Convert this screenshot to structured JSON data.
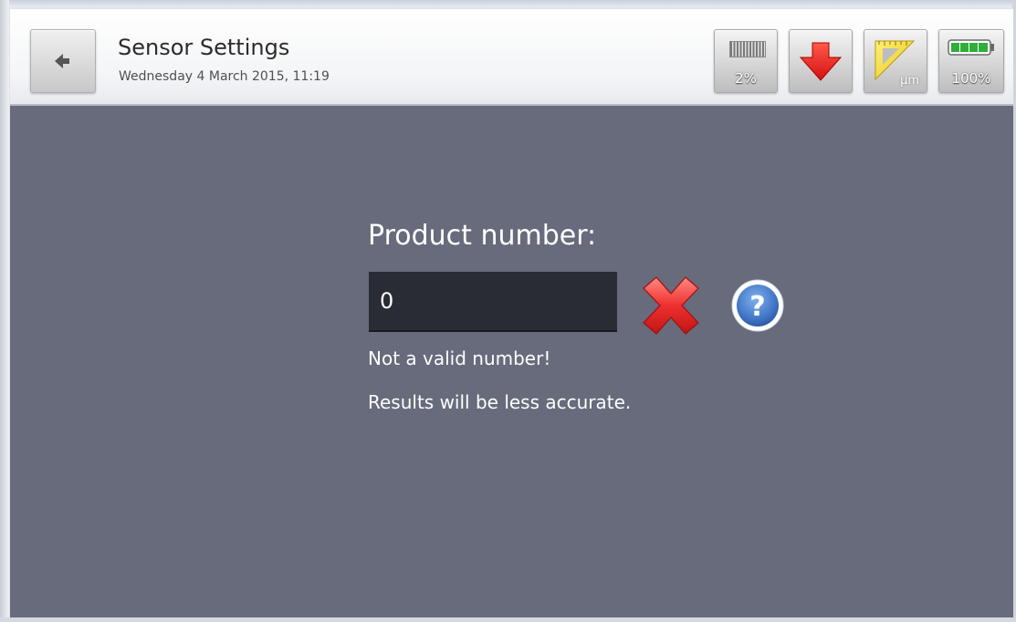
{
  "header": {
    "title": "Sensor Settings",
    "datetime": "Wednesday 4 March 2015, 11:19",
    "back_icon": "back-arrow-icon",
    "status": {
      "signal_label": "2%",
      "signal_icon": "signal-strength-icon",
      "download_icon": "red-down-arrow-icon",
      "unit_label": "µm",
      "unit_icon": "ruler-icon",
      "battery_label": "100%",
      "battery_icon": "battery-icon",
      "battery_level": 1.0
    }
  },
  "form": {
    "label": "Product number:",
    "value": "0",
    "clear_icon": "red-x-icon",
    "help_icon": "help-question-icon",
    "messages": {
      "error": "Not a valid number!",
      "warning": "Results will be less accurate."
    }
  },
  "colors": {
    "background": "#676b7c",
    "input_background": "#2a2c35",
    "text": "#ffffff",
    "error_accent": "#e23434",
    "help_accent": "#3f74c4",
    "unit_accent": "#f2d624",
    "battery_accent": "#2fae3a"
  }
}
